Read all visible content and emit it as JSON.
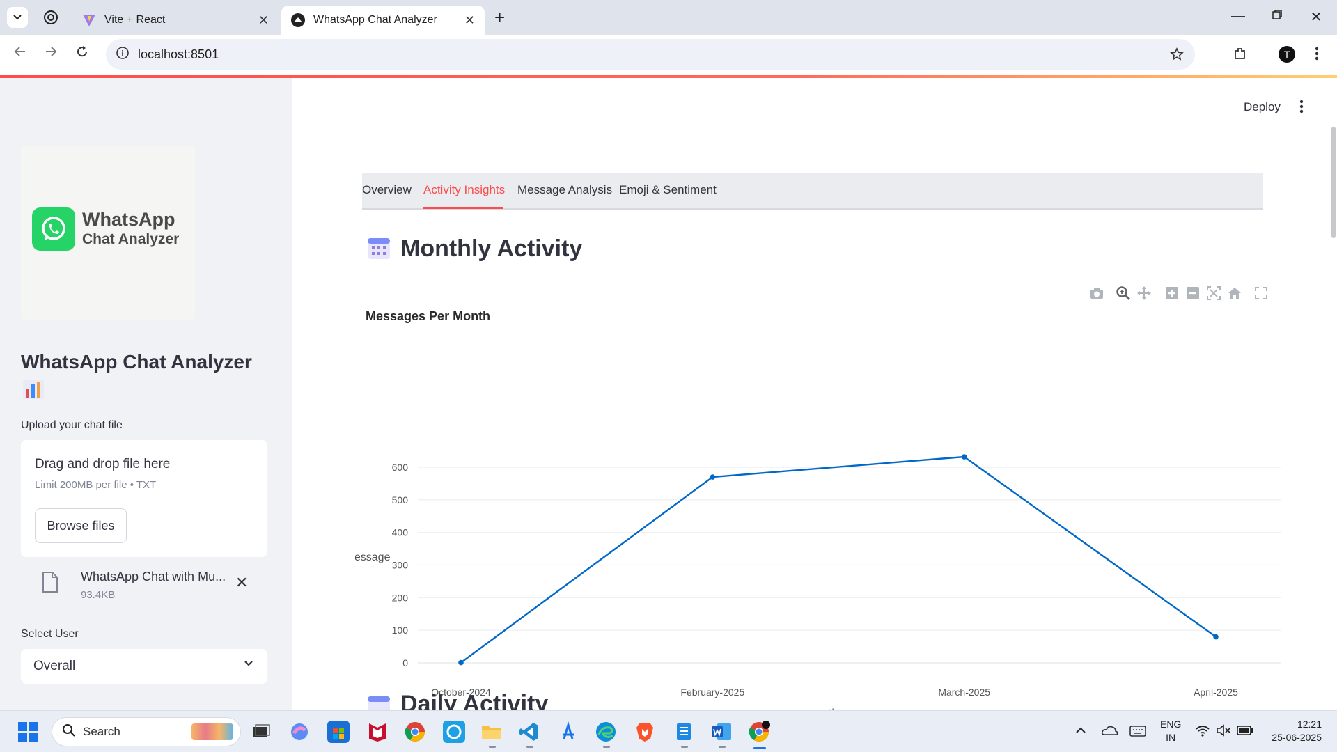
{
  "browser": {
    "tabs": [
      {
        "title": "Vite + React"
      },
      {
        "title": "WhatsApp Chat Analyzer"
      }
    ],
    "url": "localhost:8501",
    "profile_initial": "T"
  },
  "sidebar": {
    "logo_line1": "WhatsApp",
    "logo_line2": "Chat Analyzer",
    "title": "WhatsApp Chat Analyzer",
    "upload_label": "Upload your chat file",
    "dropzone_title": "Drag and drop file here",
    "dropzone_limit": "Limit 200MB per file • TXT",
    "browse_label": "Browse files",
    "file_name": "WhatsApp Chat with Mu...",
    "file_size": "93.4KB",
    "select_label": "Select User",
    "select_value": "Overall"
  },
  "header": {
    "deploy_label": "Deploy"
  },
  "tabs": [
    {
      "label": "Overview"
    },
    {
      "label": "Activity Insights"
    },
    {
      "label": "Message Analysis"
    },
    {
      "label": "Emoji & Sentiment"
    }
  ],
  "active_tab": "Activity Insights",
  "section": {
    "title": "Monthly Activity",
    "next_title": "Daily Activity"
  },
  "chart_data": {
    "type": "line",
    "title": "Messages Per Month",
    "xlabel": "time",
    "ylabel": "message",
    "categories": [
      "October-2024",
      "February-2025",
      "March-2025",
      "April-2025"
    ],
    "series": [
      {
        "values": [
          1,
          570,
          632,
          80
        ]
      }
    ],
    "ylim": [
      0,
      632
    ],
    "yticks": [
      0,
      100,
      200,
      300,
      400,
      500,
      600
    ],
    "grid": true,
    "color": "#0068c9"
  },
  "taskbar": {
    "search_placeholder": "Search",
    "lang_line1": "ENG",
    "lang_line2": "IN",
    "time": "12:21",
    "date": "25-06-2025"
  },
  "colors": {
    "accent": "#ff4b4b",
    "sidebar_bg": "#f0f2f6",
    "whatsapp_green": "#25d366"
  }
}
